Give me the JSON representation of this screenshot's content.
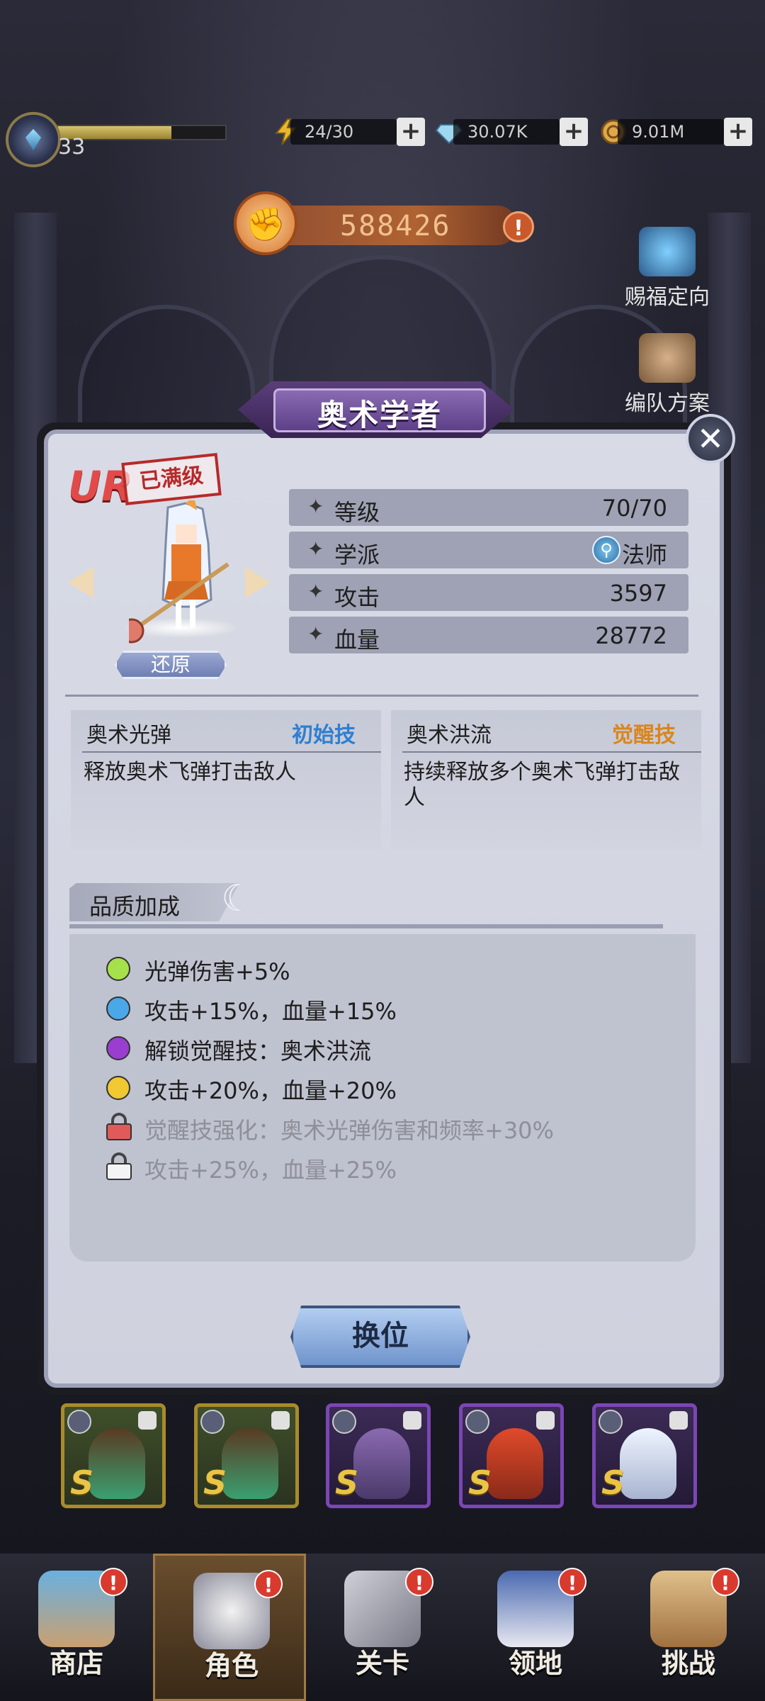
{
  "topbar": {
    "level": "33",
    "xp_fraction": 0.68,
    "stamina": "24/30",
    "gems": "30.07K",
    "coins": "9.01M",
    "plus": "+"
  },
  "power": {
    "value": "588426",
    "alert": "!"
  },
  "side": {
    "blessing": "赐福定向",
    "formation": "编队方案"
  },
  "dialog": {
    "title": "奥术学者",
    "close": "✕",
    "rarity": "UR",
    "maxed": "已满级",
    "restore": "还原",
    "stats": [
      {
        "key": "等级",
        "value": "70/70"
      },
      {
        "key": "学派",
        "value": "法师"
      },
      {
        "key": "攻击",
        "value": "3597"
      },
      {
        "key": "血量",
        "value": "28772"
      }
    ],
    "star": "✦",
    "skills": [
      {
        "name": "奥术光弹",
        "tag": "初始技",
        "desc": "释放奥术飞弹打击敌人",
        "tag_color": "#2f7fd0"
      },
      {
        "name": "奥术洪流",
        "tag": "觉醒技",
        "desc": "持续释放多个奥术飞弹打击敌人",
        "tag_color": "#d9861e"
      }
    ],
    "quality_title": "品质加成",
    "quality": [
      {
        "text": "光弹伤害+5%",
        "color": "#a6e04a"
      },
      {
        "text": "攻击+15%，血量+15%",
        "color": "#4aa8e8"
      },
      {
        "text": "解锁觉醒技：奥术洪流",
        "color": "#9a3ed0"
      },
      {
        "text": "攻击+20%，血量+20%",
        "color": "#f0c832"
      },
      {
        "text": "觉醒技强化：奥术光弹伤害和频率+30%",
        "color": "#e05a5a",
        "locked": true
      },
      {
        "text": "攻击+25%，血量+25%",
        "color": "#f4f4f4",
        "locked": true
      }
    ],
    "swap": "换位"
  },
  "roster": [
    {
      "grade": "S"
    },
    {
      "grade": "S"
    },
    {
      "grade": "S"
    },
    {
      "grade": "S"
    },
    {
      "grade": "S"
    }
  ],
  "nav": [
    {
      "label": "商店",
      "badge": "!"
    },
    {
      "label": "角色",
      "badge": "!"
    },
    {
      "label": "关卡",
      "badge": "!"
    },
    {
      "label": "领地",
      "badge": "!"
    },
    {
      "label": "挑战",
      "badge": "!"
    }
  ]
}
